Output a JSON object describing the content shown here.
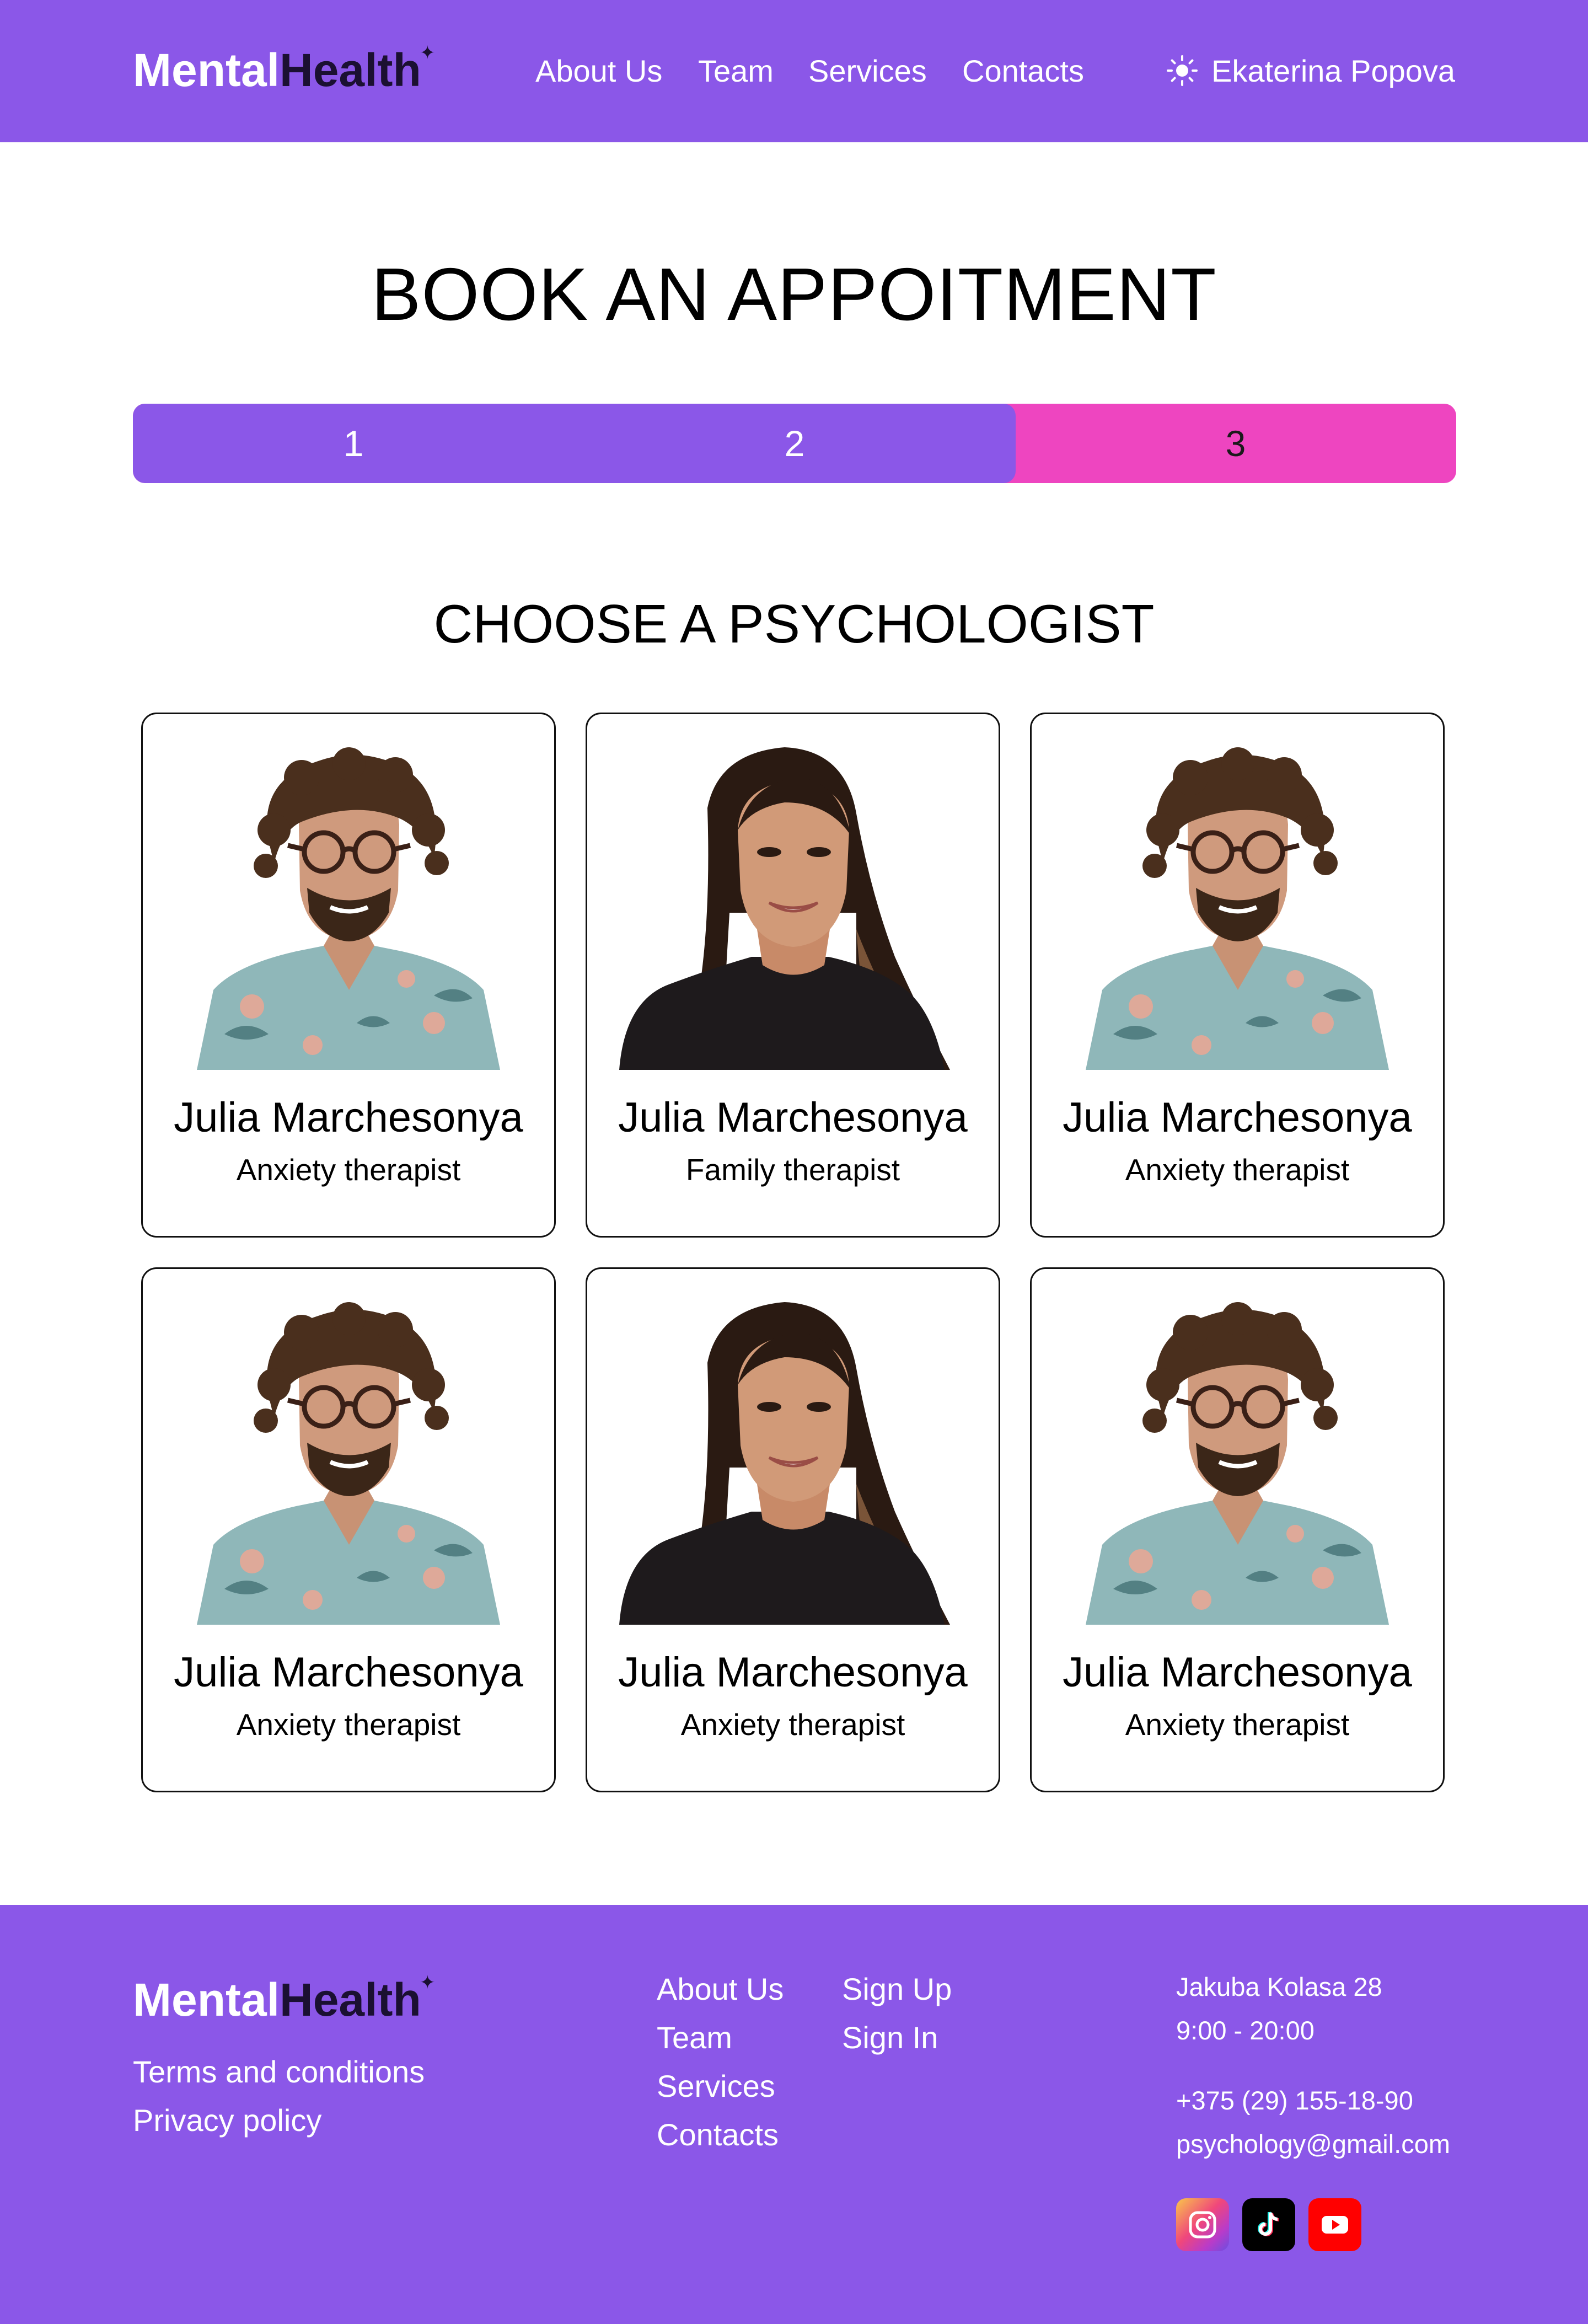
{
  "header": {
    "logo_part1": "Mental",
    "logo_part2": "Health",
    "logo_spark": "✦",
    "nav": [
      "About Us",
      "Team",
      "Services",
      "Contacts"
    ],
    "theme_icon": "sun-icon",
    "user_name": "Ekaterina Popova"
  },
  "main": {
    "title": "BOOK AN APPOITMENT",
    "stepper": {
      "steps": [
        "1",
        "2",
        "3"
      ],
      "current_step": 3,
      "completed_fraction": 0.667
    },
    "subtitle": "CHOOSE A PSYCHOLOGIST",
    "psychologists": [
      {
        "name": "Julia Marchesonya",
        "role": "Anxiety therapist",
        "photo": "male-curly-hair-glasses"
      },
      {
        "name": "Julia Marchesonya",
        "role": "Family therapist",
        "photo": "female-long-dark-hair"
      },
      {
        "name": "Julia Marchesonya",
        "role": "Anxiety therapist",
        "photo": "male-curly-hair-glasses"
      },
      {
        "name": "Julia Marchesonya",
        "role": "Anxiety therapist",
        "photo": "male-curly-hair-glasses"
      },
      {
        "name": "Julia Marchesonya",
        "role": "Anxiety therapist",
        "photo": "female-long-dark-hair"
      },
      {
        "name": "Julia Marchesonya",
        "role": "Anxiety therapist",
        "photo": "male-curly-hair-glasses"
      }
    ]
  },
  "footer": {
    "logo_part1": "Mental",
    "logo_part2": "Health",
    "logo_spark": "✦",
    "legal": [
      "Terms and conditions",
      "Privacy policy"
    ],
    "nav": [
      "About Us",
      "Team",
      "Services",
      "Contacts"
    ],
    "auth": [
      "Sign Up",
      "Sign In"
    ],
    "address": "Jakuba Kolasa 28",
    "hours": "9:00 - 20:00",
    "phone": "+375 (29) 155-18-90",
    "email": "psychology@gmail.com",
    "social": [
      "instagram-icon",
      "tiktok-icon",
      "youtube-icon"
    ]
  },
  "colors": {
    "brand": "#8b57e8",
    "accent": "#ee45c0",
    "logo_dark": "#1b1032",
    "text": "#000000"
  }
}
